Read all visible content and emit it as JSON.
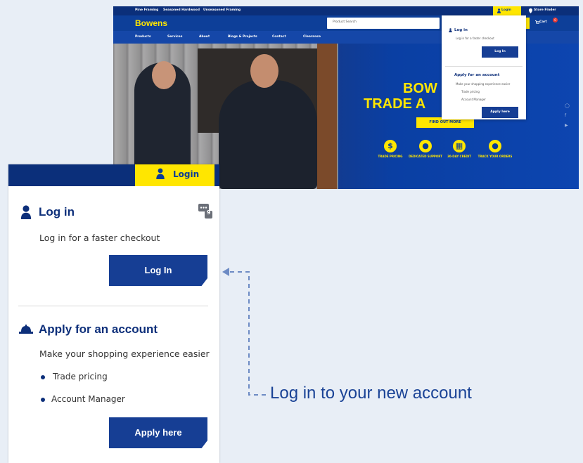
{
  "site": {
    "topbar_links": [
      "Pine Framing",
      "Seasoned Hardwood",
      "Unseasoned Framing"
    ],
    "top_login": "Login",
    "store_finder": "Store Finder",
    "logo": "Bowens",
    "search_placeholder": "Product Search",
    "cart_label": "Cart",
    "cart_count": "0",
    "nav": [
      "Products",
      "Services",
      "About",
      "Blogs & Projects",
      "Contact",
      "Clearance"
    ],
    "hero_title_line1": "BOW",
    "hero_title_line2": "TRADE A",
    "find_out_more": "FIND OUT MORE",
    "features": [
      {
        "icon": "dollar-icon",
        "label": "TRADE PRICING"
      },
      {
        "icon": "helmet-icon",
        "label": "DEDICATED SUPPORT"
      },
      {
        "icon": "calendar-icon",
        "label": "30-DAY CREDIT"
      },
      {
        "icon": "map-pin-icon",
        "label": "TRACK YOUR ORDERS"
      }
    ],
    "mini_dropdown": {
      "login_title": "Log in",
      "login_sub": "Log in for a faster checkout",
      "login_btn": "Log In",
      "apply_title": "Apply for an account",
      "apply_sub": "Make your shopping experience easier",
      "bullets": [
        "Trade pricing",
        "Account Manager"
      ],
      "apply_btn": "Apply here"
    }
  },
  "panel": {
    "top_login": "Login",
    "login_title": "Log in",
    "login_sub": "Log in for a faster checkout",
    "login_btn": "Log In",
    "apply_title": "Apply for an account",
    "apply_sub": "Make your shopping experience easier",
    "bullets": [
      "Trade pricing",
      "Account Manager"
    ],
    "apply_btn": "Apply here",
    "chat_badge": "9"
  },
  "caption": "Log in to your new account",
  "colors": {
    "brand_blue": "#0a3c96",
    "brand_yellow": "#ffe600",
    "navy": "#0d2f7a"
  }
}
